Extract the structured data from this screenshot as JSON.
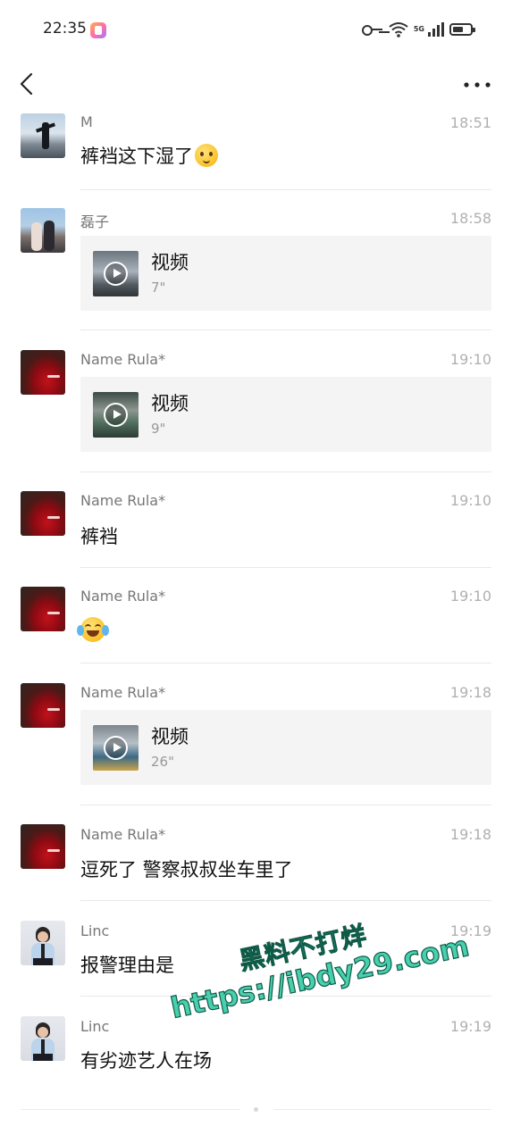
{
  "status": {
    "time": "22:35",
    "network": "5G",
    "app_icon": "gallery-app-icon",
    "icons": [
      "key-icon",
      "wifi-icon",
      "signal-icon",
      "battery-icon"
    ]
  },
  "nav": {
    "back_icon": "back-arrow-icon",
    "more_icon": "more-dots-icon"
  },
  "messages": [
    {
      "sender": "M",
      "time": "18:51",
      "type": "text",
      "text": "裤裆这下湿了",
      "emoji": "thinking-face-emoji"
    },
    {
      "sender": "磊子",
      "time": "18:58",
      "type": "video",
      "label": "视频",
      "duration": "7\""
    },
    {
      "sender": "Name Rula*",
      "time": "19:10",
      "type": "video",
      "label": "视频",
      "duration": "9\""
    },
    {
      "sender": "Name Rula*",
      "time": "19:10",
      "type": "text",
      "text": "裤裆"
    },
    {
      "sender": "Name Rula*",
      "time": "19:10",
      "type": "emoji",
      "emoji": "laughing-tears-emoji"
    },
    {
      "sender": "Name Rula*",
      "time": "19:18",
      "type": "video",
      "label": "视频",
      "duration": "26\""
    },
    {
      "sender": "Name Rula*",
      "time": "19:18",
      "type": "text",
      "text": "逗死了 警察叔叔坐车里了"
    },
    {
      "sender": "Linc",
      "time": "19:19",
      "type": "text",
      "text": "报警理由是"
    },
    {
      "sender": "Linc",
      "time": "19:19",
      "type": "text",
      "text": "有劣迹艺人在场"
    }
  ],
  "watermark": {
    "line1": "黑料不打烊",
    "line2": "https://ibdy29.com"
  },
  "colors": {
    "background": "#ffffff",
    "video_card": "#f4f4f4",
    "watermark": "#3fc1a4"
  }
}
